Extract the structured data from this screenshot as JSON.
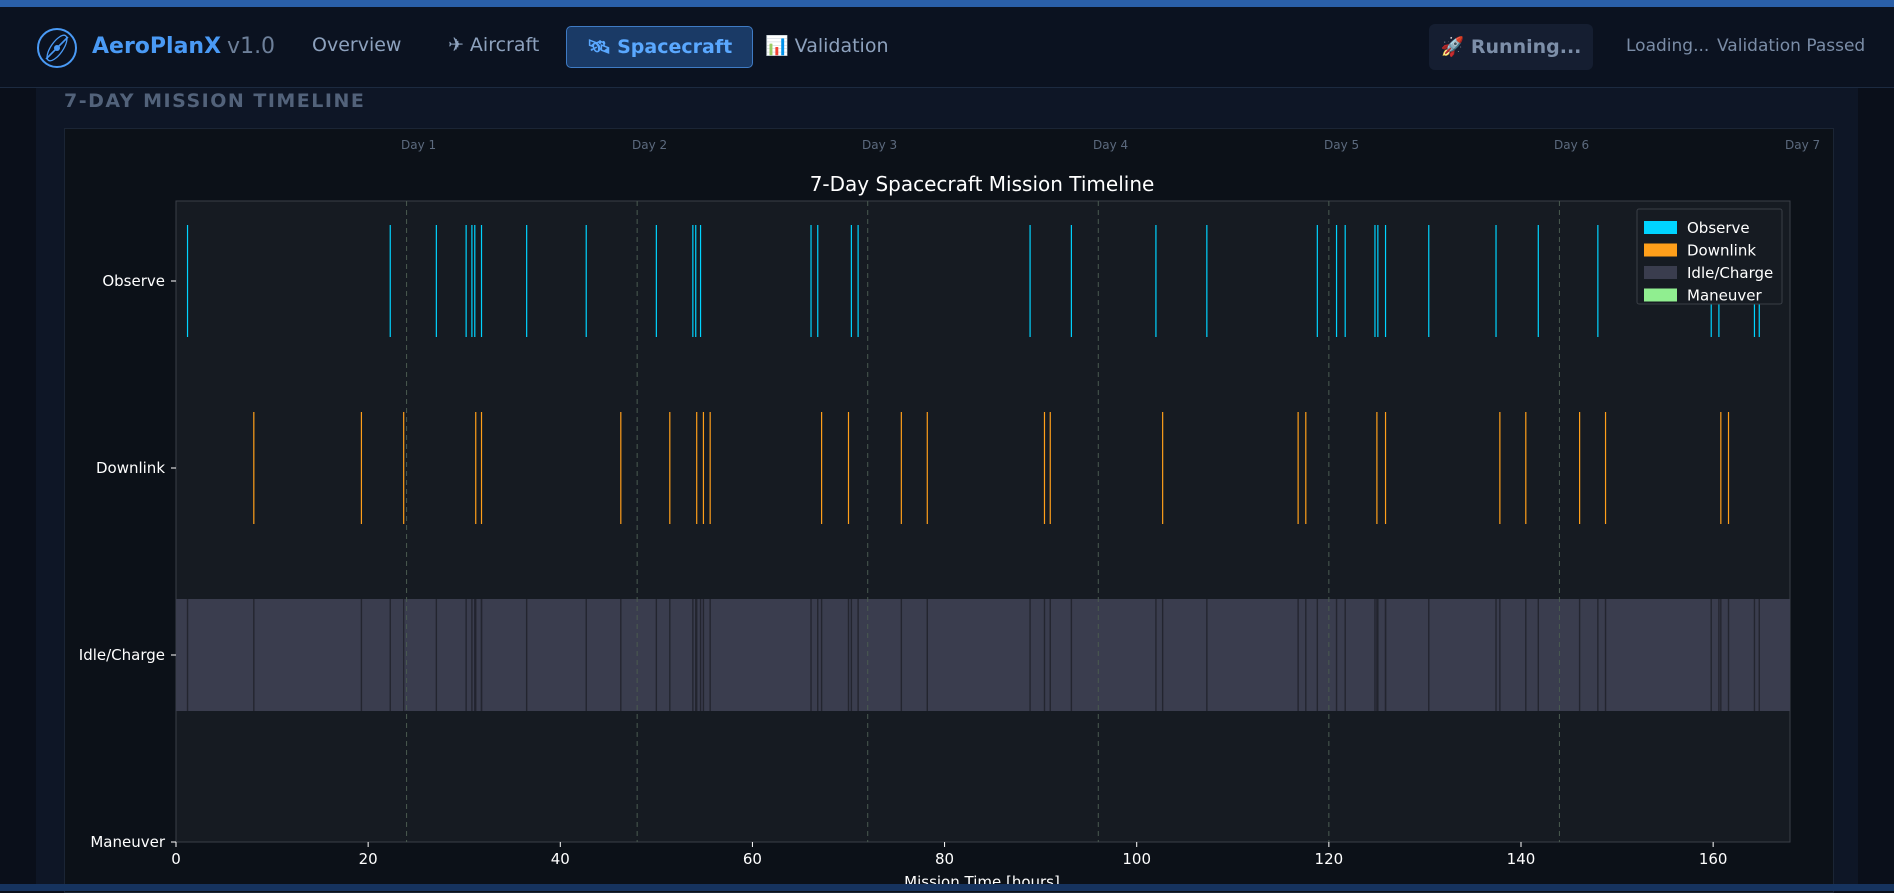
{
  "app": {
    "name": "AeroPlanX",
    "version": "v1.0"
  },
  "nav": {
    "overview": "Overview",
    "aircraft": "Aircraft",
    "spacecraft": "Spacecraft",
    "validation": "Validation",
    "aircraft_icon": "✈",
    "spacecraft_icon": "🛰",
    "validation_icon": "📊"
  },
  "status": {
    "running_icon": "🚀",
    "running": "Running...",
    "loading": "Loading...",
    "validation": "Validation Passed"
  },
  "section_title": "7-DAY MISSION TIMELINE",
  "day_labels": [
    "Day 1",
    "Day 2",
    "Day 3",
    "Day 4",
    "Day 5",
    "Day 6",
    "Day 7"
  ],
  "colors": {
    "observe": "#00d4ff",
    "downlink": "#ff9f1a",
    "idle": "#3a3d4e",
    "maneuver": "#90ee90",
    "accent": "#4a9af5"
  },
  "chart_data": {
    "type": "timeline",
    "title": "7-Day Spacecraft Mission Timeline",
    "xlabel": "Mission Time [hours]",
    "xlim": [
      0,
      168
    ],
    "xticks": [
      0,
      20,
      40,
      60,
      80,
      100,
      120,
      140,
      160
    ],
    "categories": [
      "Observe",
      "Downlink",
      "Idle/Charge",
      "Maneuver"
    ],
    "legend": [
      "Observe",
      "Downlink",
      "Idle/Charge",
      "Maneuver"
    ],
    "legend_position": "top-right",
    "day_boundaries": [
      24,
      48,
      72,
      96,
      120,
      144
    ],
    "series": [
      {
        "name": "Observe",
        "events": [
          1.2,
          22.3,
          27.1,
          30.2,
          30.8,
          31.1,
          31.8,
          36.5,
          42.7,
          50.0,
          53.8,
          54.1,
          54.6,
          66.1,
          66.8,
          70.3,
          71.0,
          88.9,
          93.2,
          102.0,
          107.3,
          118.8,
          120.8,
          121.7,
          124.8,
          125.1,
          125.9,
          130.4,
          137.4,
          141.8,
          148.0,
          159.8,
          160.6,
          164.3,
          164.8
        ]
      },
      {
        "name": "Downlink",
        "events": [
          8.1,
          19.3,
          23.7,
          31.2,
          31.8,
          46.3,
          51.4,
          54.2,
          54.9,
          55.6,
          67.2,
          70.0,
          75.5,
          78.2,
          90.4,
          91.0,
          102.7,
          116.8,
          117.6,
          125.0,
          125.9,
          137.8,
          140.5,
          146.1,
          148.8,
          160.8,
          161.6
        ]
      },
      {
        "name": "Idle/Charge",
        "range": [
          0,
          168
        ]
      },
      {
        "name": "Maneuver",
        "events": []
      }
    ]
  }
}
